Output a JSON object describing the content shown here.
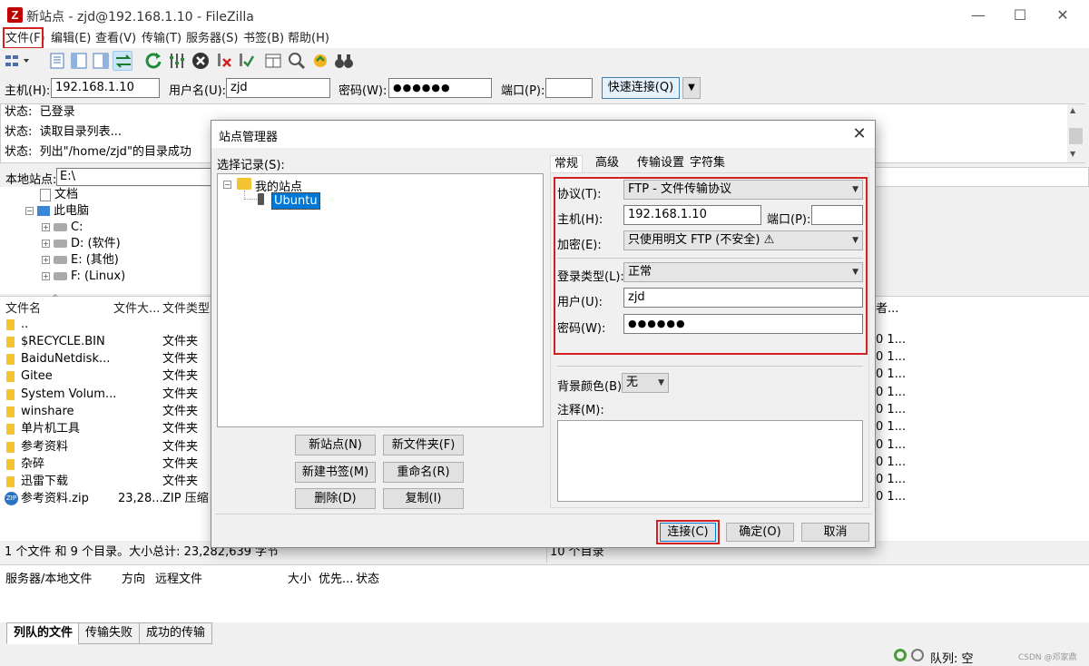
{
  "window": {
    "title": "新站点 - zjd@192.168.1.10 - FileZilla",
    "app_icon_letter": "Z",
    "minimize": "—",
    "maximize": "☐",
    "close": "✕"
  },
  "menu": [
    {
      "label": "文件(F)"
    },
    {
      "label": "编辑(E)"
    },
    {
      "label": "查看(V)"
    },
    {
      "label": "传输(T)"
    },
    {
      "label": "服务器(S)"
    },
    {
      "label": "书签(B)"
    },
    {
      "label": "帮助(H)"
    }
  ],
  "quickconnect": {
    "host_label": "主机(H):",
    "host_value": "192.168.1.10",
    "user_label": "用户名(U):",
    "user_value": "zjd",
    "pass_label": "密码(W):",
    "pass_value": "●●●●●●",
    "port_label": "端口(P):",
    "port_value": "",
    "connect_button": "快速连接(Q)",
    "dropdown_arrow": "▼"
  },
  "status_log": [
    {
      "prefix": "状态:",
      "text": "已登录"
    },
    {
      "prefix": "状态:",
      "text": "读取目录列表..."
    },
    {
      "prefix": "状态:",
      "text": "列出\"/home/zjd\"的目录成功"
    }
  ],
  "local": {
    "site_label": "本地站点:",
    "site_path": "E:\\",
    "tree": [
      {
        "label": "文档",
        "kind": "folder"
      },
      {
        "label": "此电脑",
        "kind": "computer"
      },
      {
        "label": "C:",
        "kind": "drive"
      },
      {
        "label": "D: (软件)",
        "kind": "drive"
      },
      {
        "label": "E: (其他)",
        "kind": "drive"
      },
      {
        "label": "F: (Linux)",
        "kind": "drive"
      }
    ],
    "columns": {
      "name": "文件名",
      "size": "文件大...",
      "type": "文件类型"
    },
    "files": [
      {
        "name": "..",
        "size": "",
        "type": ""
      },
      {
        "name": "$RECYCLE.BIN",
        "size": "",
        "type": "文件夹"
      },
      {
        "name": "BaiduNetdisk...",
        "size": "",
        "type": "文件夹"
      },
      {
        "name": "Gitee",
        "size": "",
        "type": "文件夹"
      },
      {
        "name": "System Volum...",
        "size": "",
        "type": "文件夹"
      },
      {
        "name": "winshare",
        "size": "",
        "type": "文件夹"
      },
      {
        "name": "单片机工具",
        "size": "",
        "type": "文件夹"
      },
      {
        "name": "参考资料",
        "size": "",
        "type": "文件夹"
      },
      {
        "name": "杂碎",
        "size": "",
        "type": "文件夹"
      },
      {
        "name": "迅雷下载",
        "size": "",
        "type": "文件夹"
      },
      {
        "name": "参考资料.zip",
        "size": "23,28...",
        "type": "ZIP 压缩"
      }
    ],
    "summary": "1 个文件 和 9 个目录。大小总计: 23,282,639 字节"
  },
  "remote": {
    "column_owner": "者...",
    "rows": [
      "0 1...",
      "0 1...",
      "0 1...",
      "0 1...",
      "0 1...",
      "0 1...",
      "0 1...",
      "0 1...",
      "0 1...",
      "0 1..."
    ],
    "summary": "10 个目录"
  },
  "queue": {
    "columns": [
      "服务器/本地文件",
      "方向",
      "远程文件",
      "大小",
      "优先...",
      "状态"
    ],
    "tabs": [
      "列队的文件",
      "传输失败",
      "成功的传输"
    ],
    "status_text": "队列: 空",
    "watermark": "CSDN @邓家鼎"
  },
  "site_manager": {
    "title": "站点管理器",
    "close": "✕",
    "select_label": "选择记录(S):",
    "root_folder": "我的站点",
    "site_entry": "Ubuntu",
    "buttons": {
      "new_site": "新站点(N)",
      "new_folder": "新文件夹(F)",
      "new_bookmark": "新建书签(M)",
      "rename": "重命名(R)",
      "delete": "删除(D)",
      "copy": "复制(I)"
    },
    "tabs": [
      "常规",
      "高级",
      "传输设置",
      "字符集"
    ],
    "general": {
      "protocol_label": "协议(T):",
      "protocol_value": "FTP - 文件传输协议",
      "host_label": "主机(H):",
      "host_value": "192.168.1.10",
      "port_label": "端口(P):",
      "port_value": "",
      "encryption_label": "加密(E):",
      "encryption_value": "只使用明文 FTP (不安全)",
      "logon_type_label": "登录类型(L):",
      "logon_type_value": "正常",
      "user_label": "用户(U):",
      "user_value": "zjd",
      "password_label": "密码(W):",
      "password_value": "●●●●●●",
      "bgcolor_label": "背景颜色(B)",
      "bgcolor_value": "无",
      "comments_label": "注释(M):",
      "comments_value": ""
    },
    "footer": {
      "connect": "连接(C)",
      "ok": "确定(O)",
      "cancel": "取消"
    }
  },
  "colors": {
    "highlight_red": "#d02020",
    "selection_blue": "#0078d7"
  }
}
